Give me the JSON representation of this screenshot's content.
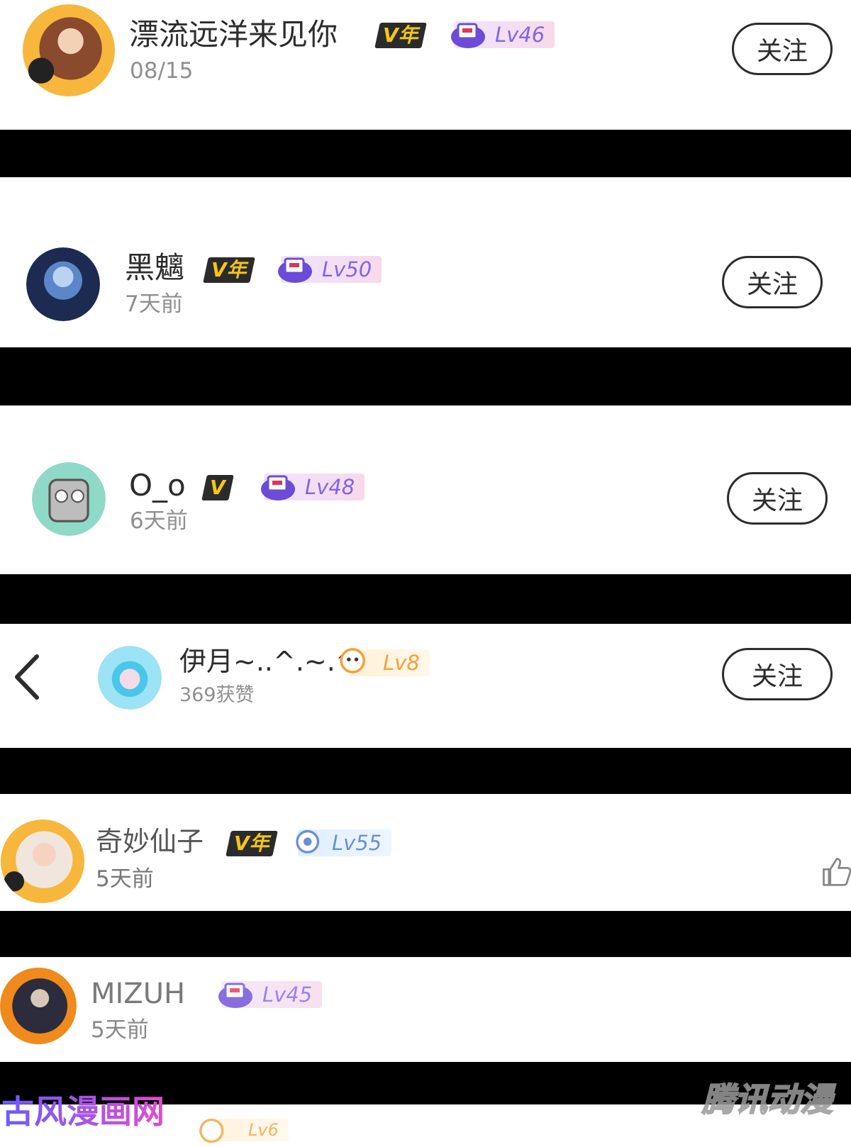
{
  "comments": [
    {
      "name": "漂流远洋来见你",
      "meta": "08/15",
      "vip": "V年",
      "level": "Lv46",
      "follow": "关注"
    },
    {
      "name": "黑魑",
      "meta": "7天前",
      "vip": "V年",
      "level": "Lv50",
      "follow": "关注"
    },
    {
      "name": "O_o",
      "meta": "6天前",
      "vip": "V",
      "level": "Lv48",
      "follow": "关注"
    },
    {
      "name": "伊月~..^.~.^",
      "meta": "369获赞",
      "level": "Lv8",
      "follow": "关注"
    },
    {
      "name": "奇妙仙子",
      "meta": "5天前",
      "vip": "V年",
      "level": "Lv55"
    },
    {
      "name": "MIZUH",
      "meta": "5天前",
      "level": "Lv45"
    }
  ],
  "partial_level": "Lv6",
  "watermarks": {
    "left": "古风漫画网",
    "right": "腾讯动漫"
  },
  "icons": {
    "back": "chevron-left-icon",
    "like": "thumbs-up-icon",
    "level": "level-mascot-icon"
  },
  "colors": {
    "level_text": "#7f66e6",
    "vip_gold": "#f5c518",
    "bar": "#000000"
  }
}
